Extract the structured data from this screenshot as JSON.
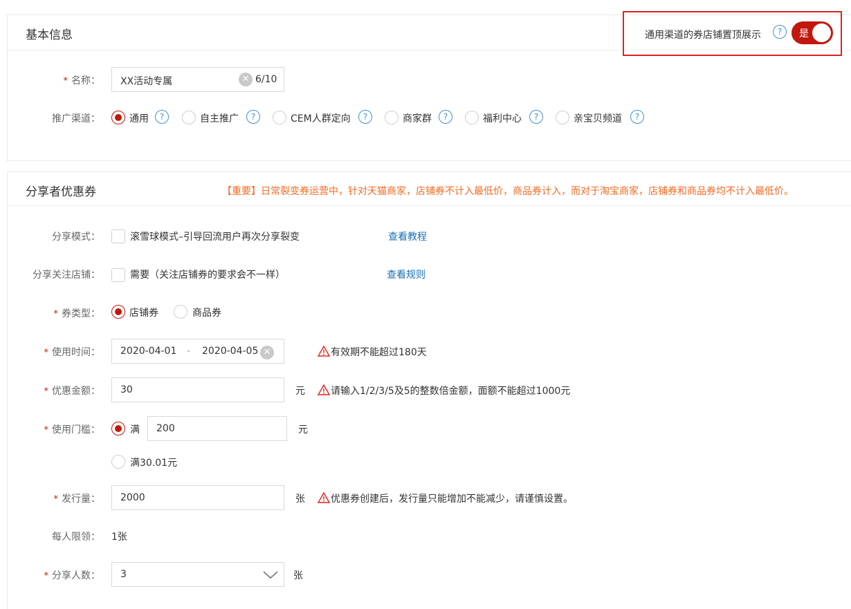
{
  "basic": {
    "title": "基本信息",
    "toggle": {
      "label": "通用渠道的券店铺置顶展示",
      "help": "?",
      "state_text": "是",
      "on": true
    },
    "name": {
      "label": "名称：",
      "value": "XX活动专属",
      "counter": "6/10",
      "required": true
    },
    "channel": {
      "label": "推广渠道：",
      "options": [
        {
          "label": "通用",
          "selected": true,
          "help": "?"
        },
        {
          "label": "自主推广",
          "selected": false,
          "help": "?"
        },
        {
          "label": "CEM人群定向",
          "selected": false,
          "help": "?"
        },
        {
          "label": "商家群",
          "selected": false,
          "help": "?"
        },
        {
          "label": "福利中心",
          "selected": false,
          "help": "?"
        },
        {
          "label": "亲宝贝频道",
          "selected": false,
          "help": "?"
        }
      ]
    }
  },
  "share": {
    "title": "分享者优惠券",
    "notice": "【重要】日常裂变券运营中，针对天猫商家，店铺券不计入最低价，商品券计入，而对于淘宝商家，店铺券和商品券均不计入最低价。",
    "mode": {
      "label": "分享模式：",
      "checkbox_label": "滚雪球模式–引导回流用户再次分享裂变",
      "link": "查看教程",
      "checked": false
    },
    "follow": {
      "label": "分享关注店铺：",
      "checkbox_label": "需要（关注店铺券的要求会不一样）",
      "link": "查看规则",
      "checked": false
    },
    "coupon_type": {
      "label": "券类型：",
      "options": [
        {
          "label": "店铺券",
          "selected": true
        },
        {
          "label": "商品券",
          "selected": false
        }
      ]
    },
    "use_time": {
      "label": "使用时间：",
      "start": "2020-04-01",
      "sep": "-",
      "end": "2020-04-05",
      "warning": "有效期不能超过180天"
    },
    "amount": {
      "label": "优惠金额：",
      "value": "30",
      "unit": "元",
      "warning": "请输入1/2/3/5及5的整数倍金额，面额不能超过1000元"
    },
    "threshold": {
      "label": "使用门槛：",
      "opt1_label": "满",
      "opt1_value": "200",
      "opt1_unit": "元",
      "opt1_selected": true,
      "opt2_label": "满30.01元",
      "opt2_selected": false
    },
    "quantity": {
      "label": "发行量：",
      "value": "2000",
      "unit": "张",
      "warning": "优惠券创建后，发行量只能增加不能减少，请谨慎设置。"
    },
    "limit": {
      "label": "每人限领：",
      "value": "1张"
    },
    "share_count": {
      "label": "分享人数：",
      "value": "3",
      "unit": "张"
    }
  },
  "colors": {
    "accent": "#c0180e",
    "link": "#1a6fb5",
    "notice": "#f26b25",
    "help": "#3f8fd8",
    "highlight_border": "#e02020"
  }
}
